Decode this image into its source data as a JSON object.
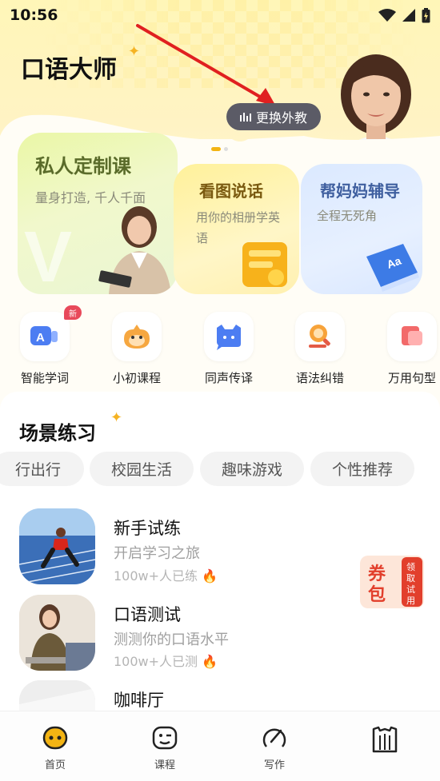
{
  "status_bar": {
    "time": "10:56"
  },
  "header": {
    "title": "口语大师",
    "switch_button": "更换外教"
  },
  "feature_cards": [
    {
      "title": "私人定制课",
      "subtitle": "量身打造, 千人千面"
    },
    {
      "title": "看图说话",
      "subtitle": "用你的相册学英语"
    },
    {
      "title": "帮妈妈辅导",
      "subtitle": "全程无死角"
    }
  ],
  "quick_actions": [
    {
      "label": "智能学词",
      "badge": "新"
    },
    {
      "label": "小初课程"
    },
    {
      "label": "同声传译"
    },
    {
      "label": "语法纠错"
    },
    {
      "label": "万用句型"
    }
  ],
  "scene_practice": {
    "title": "场景练习",
    "chips": [
      "行出行",
      "校园生活",
      "趣味游戏",
      "个性推荐"
    ],
    "lessons": [
      {
        "title": "新手试练",
        "subtitle": "开启学习之旅",
        "count": "100w+人已练"
      },
      {
        "title": "口语测试",
        "subtitle": "测测你的口语水平",
        "count": "100w+人已测"
      },
      {
        "title": "咖啡厅",
        "subtitle": "",
        "count": ""
      }
    ]
  },
  "coupon": {
    "main": "券包",
    "side": "领取试用"
  },
  "tabbar": [
    {
      "label": "首页",
      "active": true
    },
    {
      "label": "课程"
    },
    {
      "label": "写作"
    },
    {
      "label": ""
    }
  ],
  "colors": {
    "accent": "#f3b414",
    "annotation_arrow": "#e02020"
  }
}
